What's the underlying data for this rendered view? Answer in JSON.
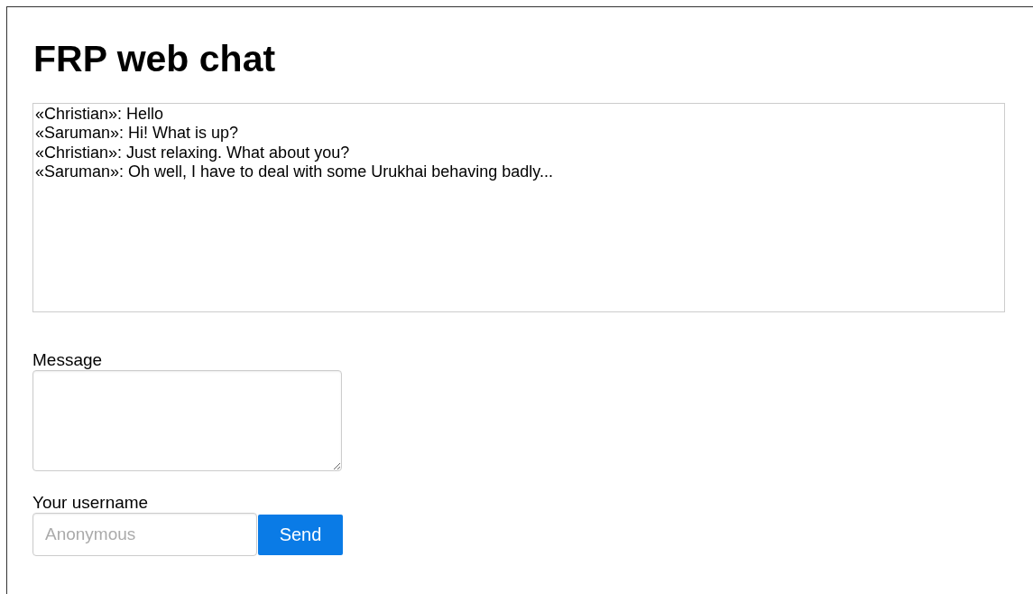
{
  "title": "FRP web chat",
  "chat_log": [
    {
      "user": "«Christian»",
      "text": ": Hello"
    },
    {
      "user": "«Saruman»",
      "text": ": Hi! What is up?"
    },
    {
      "user": "«Christian»",
      "text": ": Just relaxing. What about you?"
    },
    {
      "user": "«Saruman»",
      "text": ": Oh well, I have to deal with some Urukhai behaving badly..."
    }
  ],
  "message": {
    "label": "Message"
  },
  "username": {
    "label": "Your username",
    "placeholder": "Anonymous"
  },
  "send_button": "Send"
}
